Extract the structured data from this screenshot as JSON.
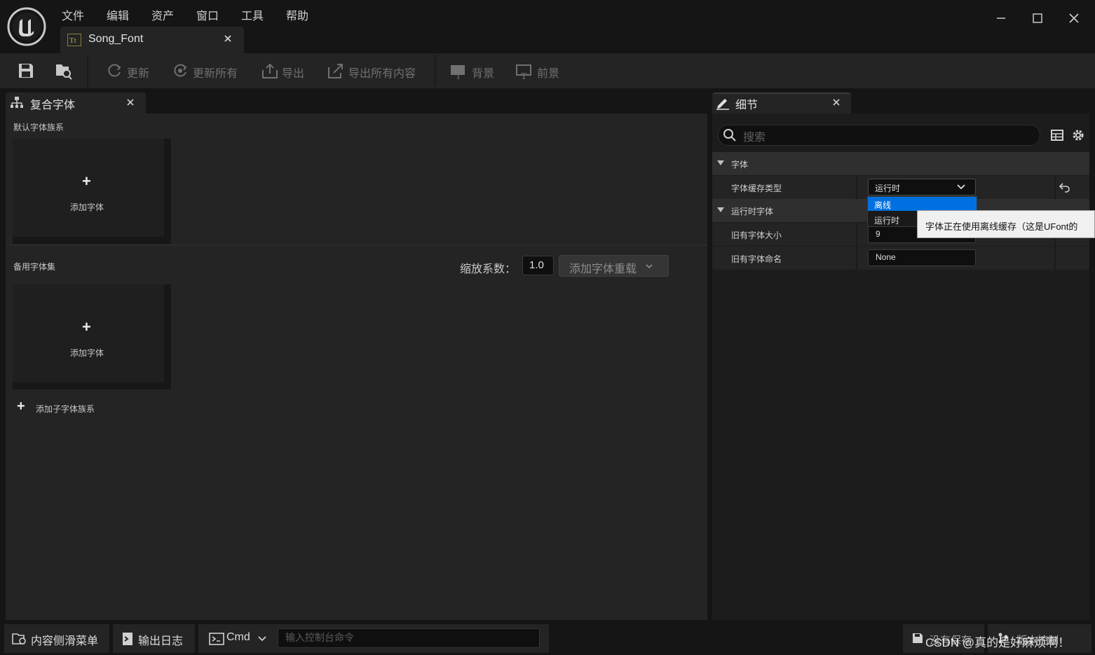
{
  "menu": [
    "文件",
    "编辑",
    "资产",
    "窗口",
    "工具",
    "帮助"
  ],
  "document_tab": {
    "label": "Song_Font"
  },
  "toolbar": {
    "update": "更新",
    "update_all": "更新所有",
    "export": "导出",
    "export_all": "导出所有内容",
    "background": "背景",
    "foreground": "前景"
  },
  "composite_panel": {
    "tab_label": "复合字体",
    "default_family_title": "默认字体族系",
    "add_font": "添加字体",
    "fallback_title": "备用字体集",
    "scale_label": "缩放系数：",
    "scale_value": "1.0",
    "add_override": "添加字体重载",
    "add_sub_family": "添加子字体族系"
  },
  "details_panel": {
    "tab_label": "细节",
    "search_placeholder": "搜索",
    "category_font": "字体",
    "cache_type_label": "字体缓存类型",
    "cache_type_value": "运行时",
    "dropdown_options": [
      "离线",
      "运行时"
    ],
    "tooltip": "字体正在使用离线缓存（这是UFont的",
    "category_runtime": "运行时字体",
    "legacy_size_label": "旧有字体大小",
    "legacy_size_value": "9",
    "legacy_name_label": "旧有字体命名",
    "legacy_name_value": "None"
  },
  "statusbar": {
    "content_drawer": "内容侧滑菜单",
    "output_log": "输出日志",
    "cmd": "Cmd",
    "console_placeholder": "输入控制台命令",
    "save_state": "没有保存",
    "source_control": "版本控制",
    "watermark": "CSDN @真的是好麻烦啊！"
  },
  "colors": {
    "selection_blue": "#0070e0",
    "panel_bg": "#242424",
    "window_bg": "#151515"
  }
}
